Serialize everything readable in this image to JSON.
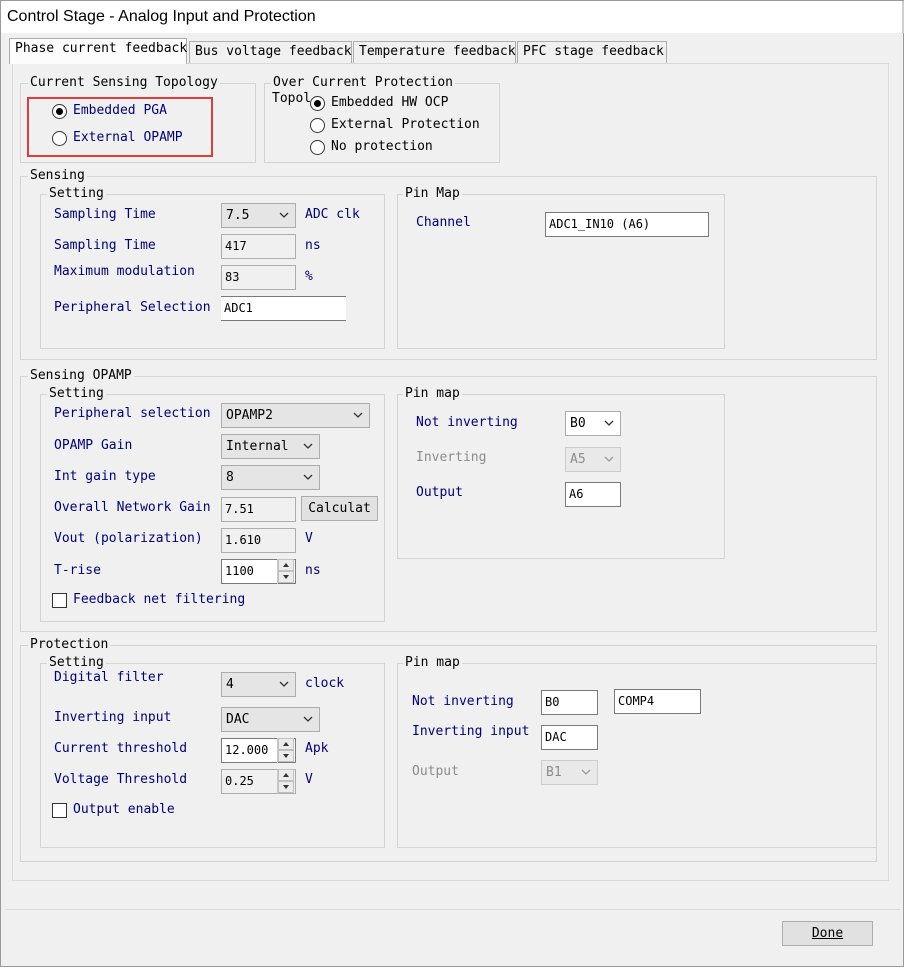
{
  "window": {
    "title": "Control Stage - Analog Input and Protection"
  },
  "tabs": [
    {
      "label": "Phase current feedback",
      "active": true
    },
    {
      "label": "Bus voltage feedback",
      "active": false
    },
    {
      "label": "Temperature feedback",
      "active": false
    },
    {
      "label": "PFC stage feedback",
      "active": false
    }
  ],
  "current_sensing_topology": {
    "title": "Current Sensing Topology",
    "options": [
      {
        "label": "Embedded PGA",
        "checked": true
      },
      {
        "label": "External OPAMP",
        "checked": false
      }
    ],
    "highlight_color": "#e03c3c"
  },
  "over_current_protection": {
    "title": "Over Current Protection",
    "title_line2": "Topol",
    "options": [
      {
        "label": "Embedded HW OCP",
        "checked": true
      },
      {
        "label": "External Protection",
        "checked": false
      },
      {
        "label": "No protection",
        "checked": false
      }
    ]
  },
  "sensing": {
    "title": "Sensing",
    "setting": {
      "title": "Setting",
      "sampling_time_label": "Sampling Time",
      "sampling_time_value": "7.5",
      "sampling_time_unit": "ADC clk",
      "sampling_time2_label": "Sampling Time",
      "sampling_time2_value": "417",
      "sampling_time2_unit": "ns",
      "max_mod_label": "Maximum modulation",
      "max_mod_value": "83",
      "max_mod_unit": "%",
      "peripheral_label": "Peripheral Selection",
      "peripheral_value": "ADC1"
    },
    "pin_map": {
      "title": "Pin Map",
      "channel_label": "Channel",
      "channel_value": "ADC1_IN10 (A6)"
    }
  },
  "sensing_opamp": {
    "title": "Sensing OPAMP",
    "setting": {
      "title": "Setting",
      "peripheral_label": "Peripheral selection",
      "peripheral_value": "OPAMP2",
      "gain_label": "OPAMP Gain",
      "gain_value": "Internal",
      "int_gain_label": "Int gain type",
      "int_gain_value": "8",
      "network_gain_label": "Overall Network Gain",
      "network_gain_value": "7.51",
      "calculate_label": "Calculat",
      "vout_label": "Vout (polarization)",
      "vout_value": "1.610",
      "vout_unit": "V",
      "trise_label": "T-rise",
      "trise_value": "1100",
      "trise_unit": "ns",
      "feedback_filter_label": "Feedback net filtering",
      "feedback_filter_checked": false
    },
    "pin_map": {
      "title": "Pin map",
      "not_inverting_label": "Not inverting",
      "not_inverting_value": "B0",
      "inverting_label": "Inverting",
      "inverting_value": "A5",
      "output_label": "Output",
      "output_value": "A6"
    }
  },
  "protection": {
    "title": "Protection",
    "setting": {
      "title": "Setting",
      "digital_filter_label": "Digital filter",
      "digital_filter_value": "4",
      "digital_filter_unit": "clock",
      "inverting_input_label": "Inverting input",
      "inverting_input_value": "DAC",
      "current_threshold_label": "Current threshold",
      "current_threshold_value": "12.000",
      "current_threshold_unit": "Apk",
      "voltage_threshold_label": "Voltage Threshold",
      "voltage_threshold_value": "0.25",
      "voltage_threshold_unit": "V",
      "output_enable_label": "Output enable",
      "output_enable_checked": false
    },
    "pin_map": {
      "title": "Pin map",
      "not_inverting_label": "Not inverting",
      "not_inverting_value": "B0",
      "comparator_value": "COMP4",
      "inverting_input_label": "Inverting input",
      "inverting_input_value": "DAC",
      "output_label": "Output",
      "output_value": "B1"
    }
  },
  "footer": {
    "done_label": "Done"
  },
  "icons": {
    "dropdown": "chevron-down-icon",
    "spin_up": "spin-up-icon",
    "spin_down": "spin-down-icon"
  }
}
